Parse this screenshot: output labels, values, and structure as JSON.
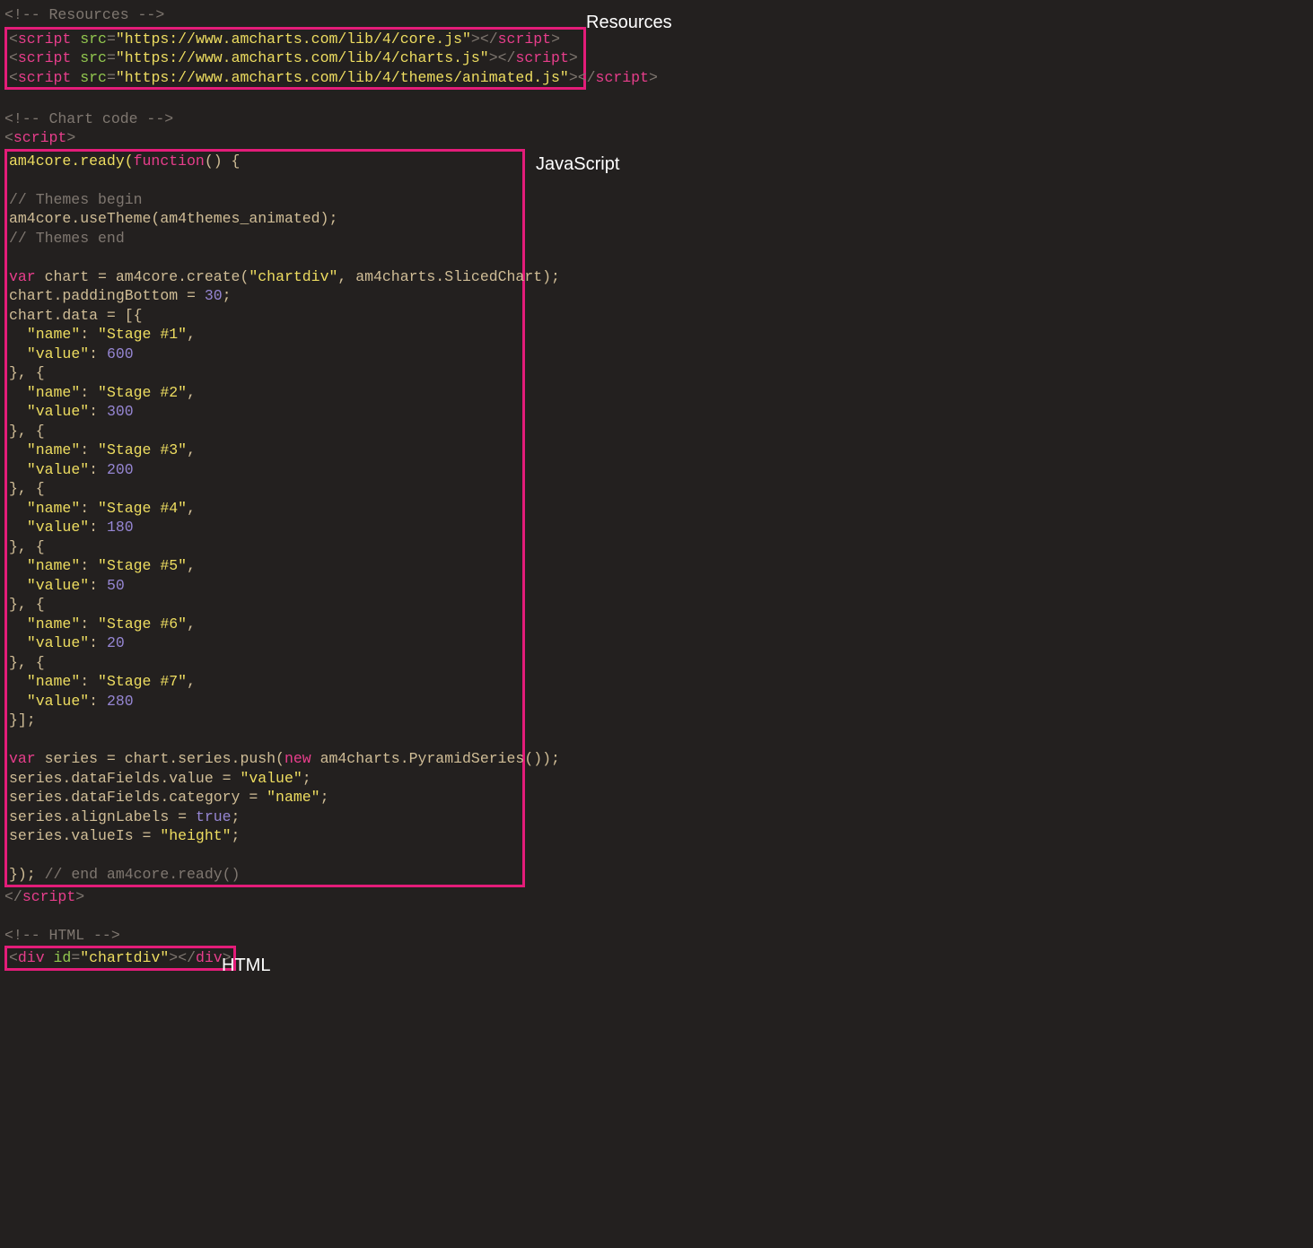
{
  "labels": {
    "resources": "Resources",
    "javascript": "JavaScript",
    "html": "HTML"
  },
  "comments": {
    "resources": "<!-- Resources -->",
    "chartcode": "<!-- Chart code -->",
    "html": "<!-- HTML -->",
    "themes_begin": "// Themes begin",
    "themes_end": "// Themes end",
    "end_ready": "// end am4core.ready()"
  },
  "resources": {
    "src1": "\"https://www.amcharts.com/lib/4/core.js\"",
    "src2": "\"https://www.amcharts.com/lib/4/charts.js\"",
    "src3": "\"https://www.amcharts.com/lib/4/themes/animated.js\""
  },
  "code": {
    "ready_open": "am4core.ready(",
    "func_kw": "function",
    "func_paren": "() {",
    "use_theme": "am4core.useTheme(am4themes_animated);",
    "var": "var",
    "decl_chart": " chart = am4core.create(",
    "str_chartdiv": "\"chartdiv\"",
    "decl_chart_tail": ", am4charts.SlicedChart);",
    "padding_pre": "chart.paddingBottom = ",
    "padding_val": "30",
    "padding_post": ";",
    "data_open": "chart.data = [{",
    "name_lbl_pre": "  ",
    "name_key": "\"name\"",
    "colon": ": ",
    "comma": ",",
    "value_key": "\"value\"",
    "item_close_cont": "}, {",
    "item_close_end": "}];",
    "stage1": "\"Stage #1\"",
    "stage2": "\"Stage #2\"",
    "stage3": "\"Stage #3\"",
    "stage4": "\"Stage #4\"",
    "stage5": "\"Stage #5\"",
    "stage6": "\"Stage #6\"",
    "stage7": "\"Stage #7\"",
    "v1": "600",
    "v2": "300",
    "v3": "200",
    "v4": "180",
    "v5": "50",
    "v6": "20",
    "v7": "280",
    "series_decl_pre": " series = chart.series.push(",
    "new_kw": "new",
    "series_decl_post": " am4charts.PyramidSeries());",
    "line_value_pre": "series.dataFields.value = ",
    "str_value": "\"value\"",
    "line_cat_pre": "series.dataFields.category = ",
    "str_name": "\"name\"",
    "semi": ";",
    "line_align_pre": "series.alignLabels = ",
    "true": "true",
    "line_valueis_pre": "series.valueIs = ",
    "str_height": "\"height\"",
    "close_ready": "}); "
  },
  "html": {
    "id_attr": "\"chartdiv\""
  },
  "tags": {
    "lt": "<",
    "gt": ">",
    "close_lt": "</",
    "script": "script",
    "div": "div",
    "src": " src",
    "id": " id",
    "eq": "="
  }
}
